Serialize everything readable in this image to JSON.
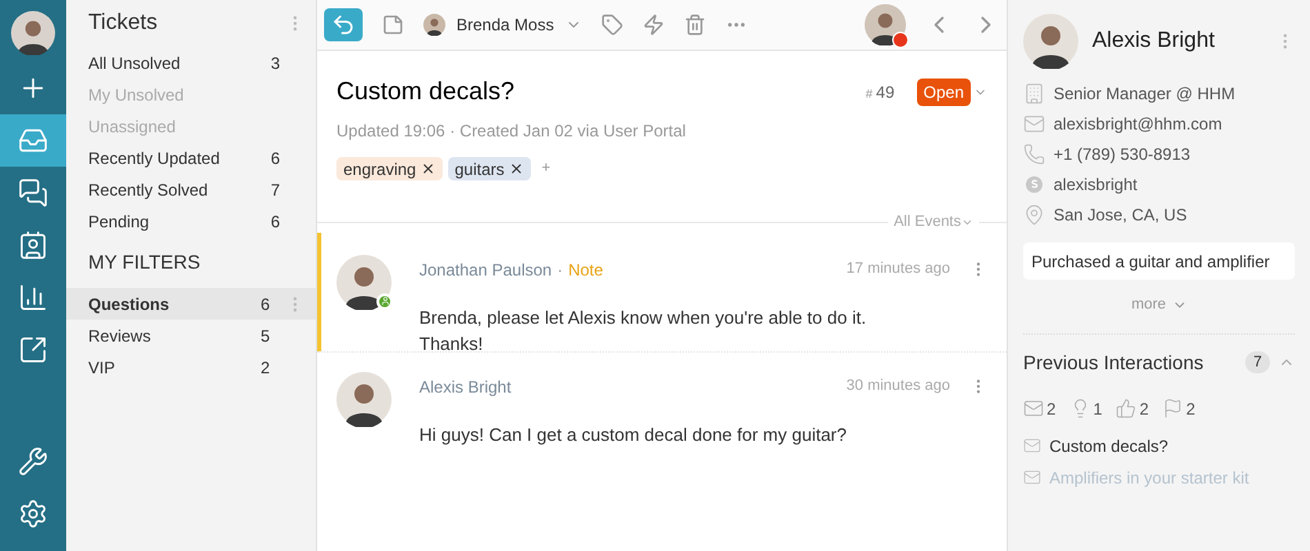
{
  "rail": {
    "top": [
      {
        "kind": "plus",
        "selected": false
      },
      {
        "kind": "inbox",
        "selected": true
      },
      {
        "kind": "chat",
        "selected": false
      },
      {
        "kind": "contacts",
        "selected": false
      },
      {
        "kind": "chart",
        "selected": false
      },
      {
        "kind": "external",
        "selected": false
      }
    ],
    "bottom": [
      {
        "kind": "wrench",
        "selected": false
      },
      {
        "kind": "settings",
        "selected": false
      }
    ]
  },
  "tickets": {
    "title": "Tickets",
    "views": [
      {
        "label": "All Unsolved",
        "count": "3",
        "disabled": false
      },
      {
        "label": "My Unsolved",
        "disabled": true
      },
      {
        "label": "Unassigned",
        "disabled": true
      },
      {
        "label": "Recently Updated",
        "count": "6",
        "disabled": false
      },
      {
        "label": "Recently Solved",
        "count": "7",
        "disabled": false
      },
      {
        "label": "Pending",
        "count": "6",
        "disabled": false
      }
    ],
    "filters_title": "MY FILTERS",
    "filters": [
      {
        "label": "Questions",
        "count": "6",
        "selected": true
      },
      {
        "label": "Reviews",
        "count": "5",
        "selected": false
      },
      {
        "label": "VIP",
        "count": "2",
        "selected": false
      }
    ]
  },
  "toolbar": {
    "assignee": "Brenda Moss"
  },
  "ticket": {
    "title": "Custom decals?",
    "hash": "#",
    "number": "49",
    "status": "Open",
    "meta": "Updated 19:06 · Created Jan 02 via User Portal",
    "tags": [
      {
        "label": "engraving",
        "color": "#fbe9db"
      },
      {
        "label": "guitars",
        "color": "#dde5f1"
      }
    ],
    "add_tag": "+"
  },
  "events_filter": "All Events",
  "messages": [
    {
      "author": "Jonathan Paulson",
      "note": true,
      "note_label": "Note",
      "separator": "·",
      "time": "17 minutes ago",
      "body": "Brenda, please let Alexis know when you're able to do it.\nThanks!",
      "online": true
    },
    {
      "author": "Alexis Bright",
      "note": false,
      "time": "30 minutes ago",
      "body": "Hi guys! Can I get a custom decal done for my guitar?",
      "online": false
    }
  ],
  "contact": {
    "name": "Alexis Bright",
    "details": [
      {
        "kind": "company",
        "text": "Senior Manager @ HHM"
      },
      {
        "kind": "email",
        "text": "alexisbright@hhm.com"
      },
      {
        "kind": "phone",
        "text": "+1 (789) 530-8913"
      },
      {
        "kind": "skype",
        "text": "alexisbright"
      },
      {
        "kind": "location",
        "text": "San Jose, CA, US"
      }
    ],
    "notes": "Purchased a guitar and amplifier",
    "more": "more",
    "interactions_title": "Previous Interactions",
    "interactions_count": "7",
    "stats": [
      {
        "kind": "email",
        "count": "2"
      },
      {
        "kind": "idea",
        "count": "1"
      },
      {
        "kind": "like",
        "count": "2"
      },
      {
        "kind": "flag",
        "count": "2"
      }
    ],
    "history": [
      {
        "subject": "Custom decals?",
        "muted": false
      },
      {
        "subject": "Amplifiers in your starter kit",
        "muted": true
      }
    ]
  }
}
